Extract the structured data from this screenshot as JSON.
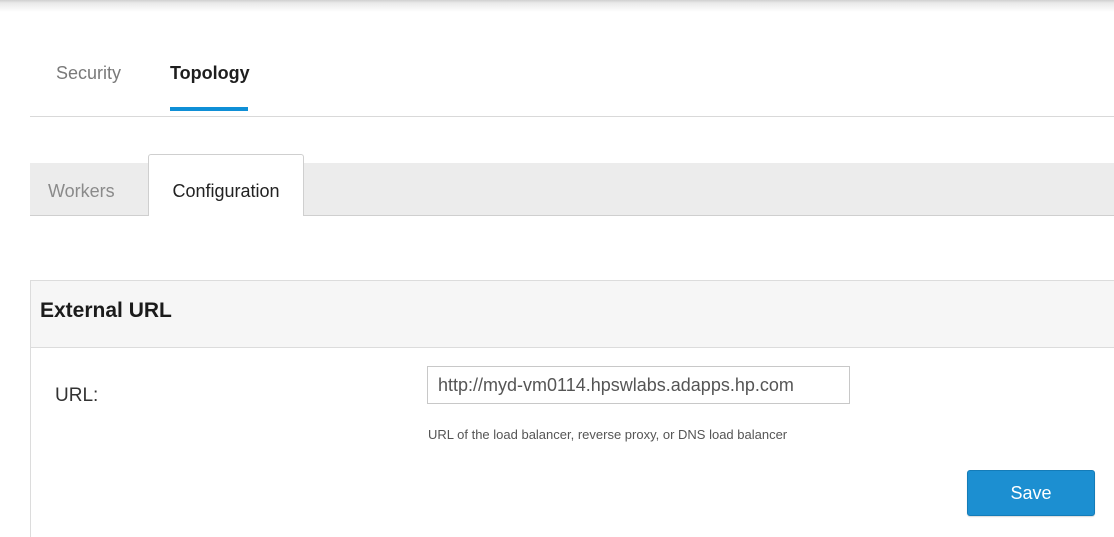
{
  "top_tabs": {
    "items": [
      {
        "label": "Security",
        "active": false
      },
      {
        "label": "Topology",
        "active": true
      }
    ]
  },
  "sub_tabs": {
    "items": [
      {
        "label": "Workers",
        "active": false
      },
      {
        "label": "Configuration",
        "active": true
      }
    ]
  },
  "external_url_section": {
    "title": "External URL",
    "url_label": "URL:",
    "url_value": "http://myd-vm0114.hpswlabs.adapps.hp.com",
    "help_text": "URL of the load balancer, reverse proxy, or DNS load balancer",
    "save_label": "Save"
  },
  "colors": {
    "accent": "#0f8fd6",
    "save_button": "#1c8fd1"
  }
}
